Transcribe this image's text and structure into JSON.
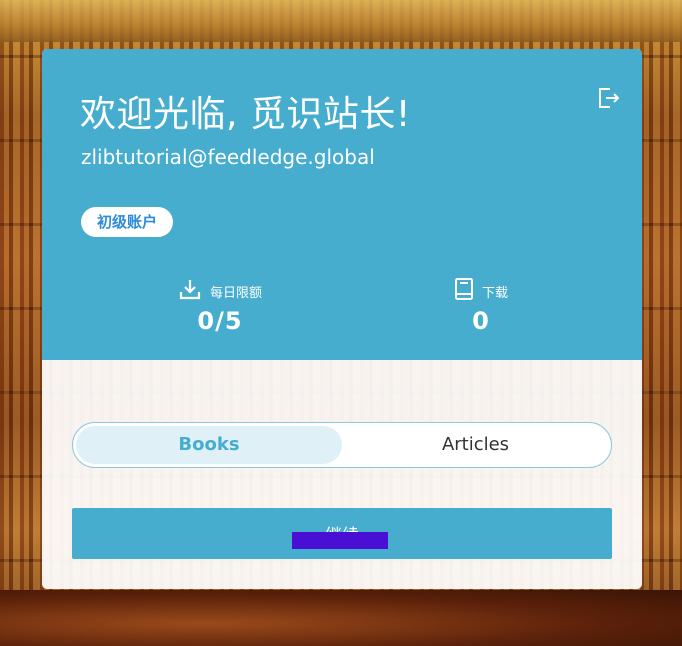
{
  "header": {
    "welcome": "欢迎光临, 觅识站长!",
    "email": "zlibtutorial@feedledge.global",
    "account_badge": "初级账户",
    "logout_icon": "logout-icon"
  },
  "stats": {
    "daily_limit": {
      "label": "每日限额",
      "value": "0/5",
      "icon": "download-icon"
    },
    "downloads": {
      "label": "下载",
      "value": "0",
      "icon": "book-icon"
    }
  },
  "tabs": {
    "items": [
      {
        "label": "Books",
        "active": true
      },
      {
        "label": "Articles",
        "active": false
      }
    ]
  },
  "actions": {
    "continue_label": "继续"
  },
  "colors": {
    "primary": "#47adcf",
    "badge_text": "#2f8cd8",
    "redaction": "#4a0fd4"
  }
}
